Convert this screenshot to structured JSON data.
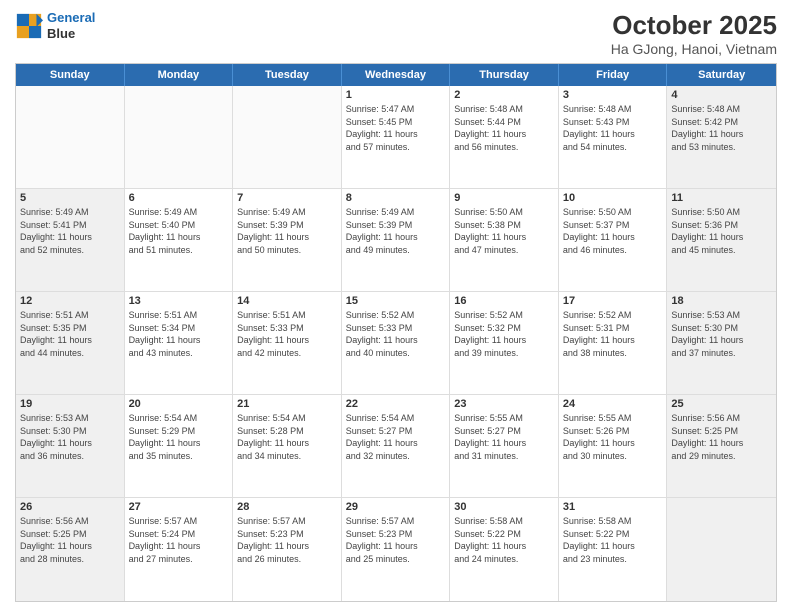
{
  "header": {
    "logo_line1": "General",
    "logo_line2": "Blue",
    "title": "October 2025",
    "subtitle": "Ha GJong, Hanoi, Vietnam"
  },
  "days_of_week": [
    "Sunday",
    "Monday",
    "Tuesday",
    "Wednesday",
    "Thursday",
    "Friday",
    "Saturday"
  ],
  "weeks": [
    [
      {
        "day": "",
        "info": "",
        "empty": true
      },
      {
        "day": "",
        "info": "",
        "empty": true
      },
      {
        "day": "",
        "info": "",
        "empty": true
      },
      {
        "day": "1",
        "info": "Sunrise: 5:47 AM\nSunset: 5:45 PM\nDaylight: 11 hours\nand 57 minutes."
      },
      {
        "day": "2",
        "info": "Sunrise: 5:48 AM\nSunset: 5:44 PM\nDaylight: 11 hours\nand 56 minutes."
      },
      {
        "day": "3",
        "info": "Sunrise: 5:48 AM\nSunset: 5:43 PM\nDaylight: 11 hours\nand 54 minutes."
      },
      {
        "day": "4",
        "info": "Sunrise: 5:48 AM\nSunset: 5:42 PM\nDaylight: 11 hours\nand 53 minutes.",
        "shaded": true
      }
    ],
    [
      {
        "day": "5",
        "info": "Sunrise: 5:49 AM\nSunset: 5:41 PM\nDaylight: 11 hours\nand 52 minutes.",
        "shaded": true
      },
      {
        "day": "6",
        "info": "Sunrise: 5:49 AM\nSunset: 5:40 PM\nDaylight: 11 hours\nand 51 minutes."
      },
      {
        "day": "7",
        "info": "Sunrise: 5:49 AM\nSunset: 5:39 PM\nDaylight: 11 hours\nand 50 minutes."
      },
      {
        "day": "8",
        "info": "Sunrise: 5:49 AM\nSunset: 5:39 PM\nDaylight: 11 hours\nand 49 minutes."
      },
      {
        "day": "9",
        "info": "Sunrise: 5:50 AM\nSunset: 5:38 PM\nDaylight: 11 hours\nand 47 minutes."
      },
      {
        "day": "10",
        "info": "Sunrise: 5:50 AM\nSunset: 5:37 PM\nDaylight: 11 hours\nand 46 minutes."
      },
      {
        "day": "11",
        "info": "Sunrise: 5:50 AM\nSunset: 5:36 PM\nDaylight: 11 hours\nand 45 minutes.",
        "shaded": true
      }
    ],
    [
      {
        "day": "12",
        "info": "Sunrise: 5:51 AM\nSunset: 5:35 PM\nDaylight: 11 hours\nand 44 minutes.",
        "shaded": true
      },
      {
        "day": "13",
        "info": "Sunrise: 5:51 AM\nSunset: 5:34 PM\nDaylight: 11 hours\nand 43 minutes."
      },
      {
        "day": "14",
        "info": "Sunrise: 5:51 AM\nSunset: 5:33 PM\nDaylight: 11 hours\nand 42 minutes."
      },
      {
        "day": "15",
        "info": "Sunrise: 5:52 AM\nSunset: 5:33 PM\nDaylight: 11 hours\nand 40 minutes."
      },
      {
        "day": "16",
        "info": "Sunrise: 5:52 AM\nSunset: 5:32 PM\nDaylight: 11 hours\nand 39 minutes."
      },
      {
        "day": "17",
        "info": "Sunrise: 5:52 AM\nSunset: 5:31 PM\nDaylight: 11 hours\nand 38 minutes."
      },
      {
        "day": "18",
        "info": "Sunrise: 5:53 AM\nSunset: 5:30 PM\nDaylight: 11 hours\nand 37 minutes.",
        "shaded": true
      }
    ],
    [
      {
        "day": "19",
        "info": "Sunrise: 5:53 AM\nSunset: 5:30 PM\nDaylight: 11 hours\nand 36 minutes.",
        "shaded": true
      },
      {
        "day": "20",
        "info": "Sunrise: 5:54 AM\nSunset: 5:29 PM\nDaylight: 11 hours\nand 35 minutes."
      },
      {
        "day": "21",
        "info": "Sunrise: 5:54 AM\nSunset: 5:28 PM\nDaylight: 11 hours\nand 34 minutes."
      },
      {
        "day": "22",
        "info": "Sunrise: 5:54 AM\nSunset: 5:27 PM\nDaylight: 11 hours\nand 32 minutes."
      },
      {
        "day": "23",
        "info": "Sunrise: 5:55 AM\nSunset: 5:27 PM\nDaylight: 11 hours\nand 31 minutes."
      },
      {
        "day": "24",
        "info": "Sunrise: 5:55 AM\nSunset: 5:26 PM\nDaylight: 11 hours\nand 30 minutes."
      },
      {
        "day": "25",
        "info": "Sunrise: 5:56 AM\nSunset: 5:25 PM\nDaylight: 11 hours\nand 29 minutes.",
        "shaded": true
      }
    ],
    [
      {
        "day": "26",
        "info": "Sunrise: 5:56 AM\nSunset: 5:25 PM\nDaylight: 11 hours\nand 28 minutes.",
        "shaded": true
      },
      {
        "day": "27",
        "info": "Sunrise: 5:57 AM\nSunset: 5:24 PM\nDaylight: 11 hours\nand 27 minutes."
      },
      {
        "day": "28",
        "info": "Sunrise: 5:57 AM\nSunset: 5:23 PM\nDaylight: 11 hours\nand 26 minutes."
      },
      {
        "day": "29",
        "info": "Sunrise: 5:57 AM\nSunset: 5:23 PM\nDaylight: 11 hours\nand 25 minutes."
      },
      {
        "day": "30",
        "info": "Sunrise: 5:58 AM\nSunset: 5:22 PM\nDaylight: 11 hours\nand 24 minutes."
      },
      {
        "day": "31",
        "info": "Sunrise: 5:58 AM\nSunset: 5:22 PM\nDaylight: 11 hours\nand 23 minutes."
      },
      {
        "day": "",
        "info": "",
        "empty": true,
        "shaded": true
      }
    ]
  ]
}
